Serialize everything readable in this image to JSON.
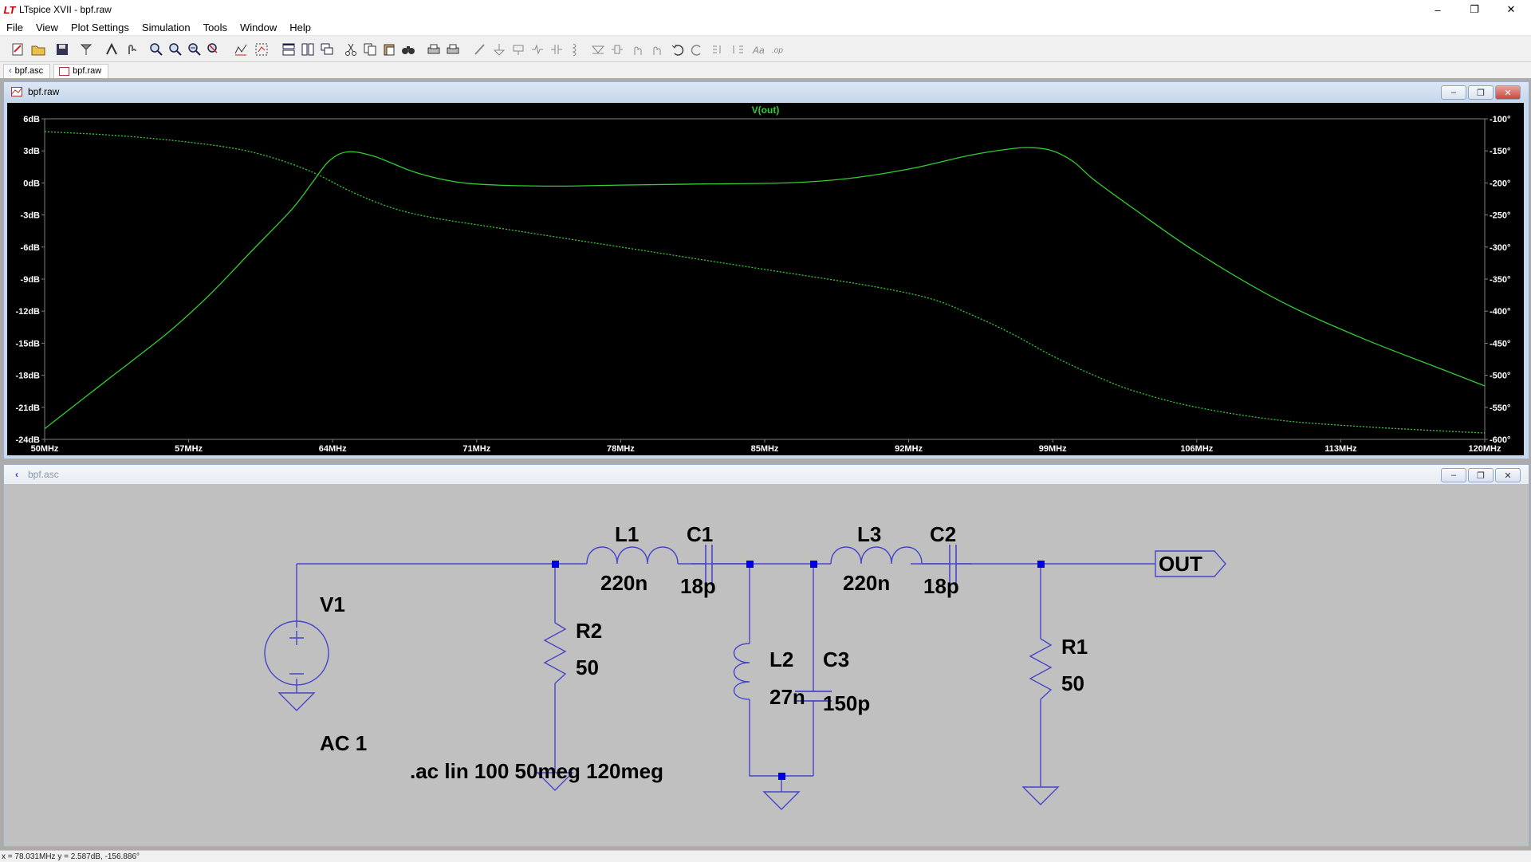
{
  "app": {
    "title": "LTspice XVII - bpf.raw",
    "logo": "LT",
    "window_controls": {
      "minimize": "–",
      "maximize": "❐",
      "close": "✕"
    }
  },
  "menu": [
    "File",
    "View",
    "Plot Settings",
    "Simulation",
    "Tools",
    "Window",
    "Help"
  ],
  "toolbar_icons": [
    "new-schematic-icon",
    "open-icon",
    "save-icon",
    "control-panel-icon",
    "run-icon",
    "halt-icon",
    "zoom-in-icon",
    "zoom-box-icon",
    "zoom-out-icon",
    "zoom-fit-icon",
    "autorange-icon",
    "zoom-extent-icon",
    "tile-horizontal-icon",
    "tile-vertical-icon",
    "cascade-icon",
    "cut-icon",
    "copy-icon",
    "paste-icon",
    "find-icon",
    "print-icon",
    "print-setup-icon",
    "wire-icon",
    "ground-icon",
    "label-icon",
    "resistor-icon",
    "capacitor-icon",
    "inductor-icon",
    "diode-icon",
    "component-icon",
    "move-icon",
    "drag-icon",
    "undo-icon",
    "redo-icon",
    "rotate-icon",
    "mirror-icon",
    "text-icon",
    "spice-directive-icon"
  ],
  "tabs": [
    {
      "label": "bpf.asc",
      "icon": "schematic-icon"
    },
    {
      "label": "bpf.raw",
      "icon": "waveform-icon"
    }
  ],
  "waveform_window": {
    "title": "bpf.raw"
  },
  "schematic_window": {
    "title": "bpf.asc"
  },
  "colors": {
    "trace": "#33cc33",
    "wire": "#4646c8",
    "plot_bg": "#000000",
    "schematic_bg": "#c0c0c0"
  },
  "chart_data": {
    "type": "line",
    "title": "V(out)",
    "xlabel": "",
    "ylabel": "",
    "x_ticks": [
      "50MHz",
      "57MHz",
      "64MHz",
      "71MHz",
      "78MHz",
      "85MHz",
      "92MHz",
      "99MHz",
      "106MHz",
      "113MHz",
      "120MHz"
    ],
    "y_ticks_left": [
      "6dB",
      "3dB",
      "0dB",
      "-3dB",
      "-6dB",
      "-9dB",
      "-12dB",
      "-15dB",
      "-18dB",
      "-21dB",
      "-24dB"
    ],
    "y_ticks_right": [
      "-100°",
      "-150°",
      "-200°",
      "-250°",
      "-300°",
      "-350°",
      "-400°",
      "-450°",
      "-500°",
      "-550°",
      "-600°"
    ],
    "xlim": [
      50,
      120
    ],
    "ylim_left": [
      -24,
      6
    ],
    "ylim_right": [
      -600,
      -100
    ],
    "grid": false,
    "series": [
      {
        "style": "solid",
        "axis": "left",
        "x": [
          50,
          53,
          56,
          58,
          60,
          62,
          63,
          63.8,
          64.7,
          66,
          68,
          70,
          72,
          75,
          78,
          82,
          86,
          89,
          92,
          95,
          97,
          98,
          99,
          100,
          101,
          103,
          106,
          110,
          114,
          118,
          120
        ],
        "y": [
          -23,
          -18.5,
          -14,
          -10.5,
          -6.5,
          -2.5,
          0,
          2,
          2.9,
          2.5,
          1,
          0.1,
          -0.2,
          -0.3,
          -0.2,
          -0.1,
          0,
          0.4,
          1.3,
          2.6,
          3.2,
          3.3,
          3.0,
          2.0,
          0.3,
          -2.5,
          -6.5,
          -11,
          -14.5,
          -17.5,
          -19
        ]
      },
      {
        "style": "dashed",
        "axis": "right",
        "x": [
          50,
          53,
          56,
          59,
          61,
          63,
          65,
          67,
          69,
          72,
          76,
          80,
          85,
          90,
          93,
          95,
          97,
          99,
          101,
          103,
          106,
          110,
          114,
          118,
          120
        ],
        "y": [
          -120,
          -125,
          -133,
          -145,
          -160,
          -183,
          -215,
          -240,
          -255,
          -270,
          -290,
          -310,
          -335,
          -360,
          -380,
          -405,
          -435,
          -470,
          -500,
          -525,
          -550,
          -570,
          -580,
          -587,
          -590
        ]
      }
    ]
  },
  "schematic": {
    "components": {
      "V1": {
        "name": "V1",
        "value": "AC 1"
      },
      "R2": {
        "name": "R2",
        "value": "50"
      },
      "L1": {
        "name": "L1",
        "value": "220n"
      },
      "C1": {
        "name": "C1",
        "value": "18p"
      },
      "L2": {
        "name": "L2",
        "value": "27n"
      },
      "C3": {
        "name": "C3",
        "value": "150p"
      },
      "L3": {
        "name": "L3",
        "value": "220n"
      },
      "C2": {
        "name": "C2",
        "value": "18p"
      },
      "R1": {
        "name": "R1",
        "value": "50"
      }
    },
    "out_label": "OUT",
    "directive": ".ac lin 100 50meg 120meg"
  },
  "status": {
    "text": "x = 78.031MHz    y = 2.587dB, -156.886°"
  }
}
